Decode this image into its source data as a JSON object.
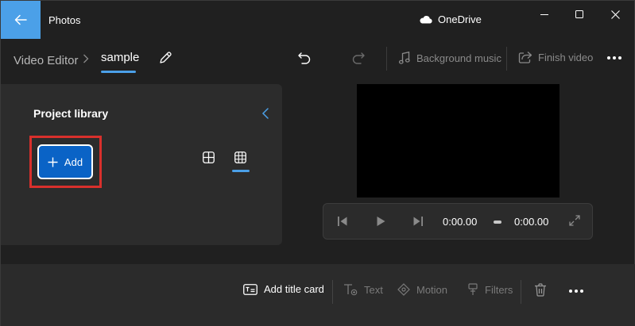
{
  "titlebar": {
    "app_title": "Photos",
    "cloud_label": "OneDrive"
  },
  "breadcrumb": {
    "root": "Video Editor",
    "current": "sample"
  },
  "toolbar": {
    "background_music_label": "Background music",
    "finish_video_label": "Finish video"
  },
  "library": {
    "title": "Project library",
    "add_label": "Add"
  },
  "player": {
    "current_time": "0:00.00",
    "total_time": "0:00.00"
  },
  "storyboard": {
    "add_title_card_label": "Add title card",
    "text_label": "Text",
    "motion_label": "Motion",
    "filters_label": "Filters"
  },
  "colors": {
    "accent": "#4ba0e8",
    "primary_button": "#0a63c6",
    "highlight_box": "#d9302c",
    "background": "#202020",
    "panel": "#2c2c2c"
  }
}
